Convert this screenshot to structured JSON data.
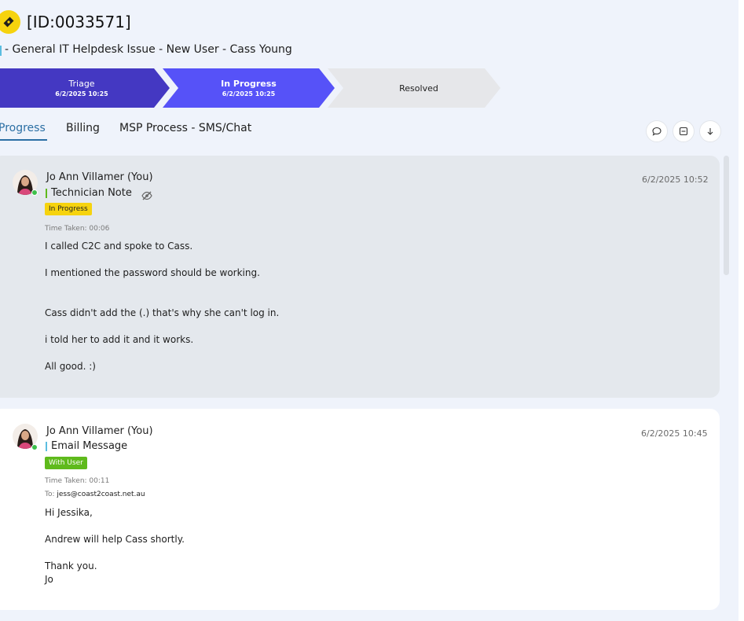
{
  "ticket": {
    "id": "[ID:0033571]",
    "subtitle": "- General IT Helpdesk Issue - New User - Cass Young"
  },
  "steps": [
    {
      "label": "Triage",
      "date": "6/2/2025 10:25"
    },
    {
      "label": "In Progress",
      "date": "6/2/2025 10:25"
    },
    {
      "label": "Resolved"
    }
  ],
  "tabs": [
    "Progress",
    "Billing",
    "MSP Process - SMS/Chat"
  ],
  "notes": [
    {
      "author": "Jo Ann Villamer (You)",
      "type": "Technician Note",
      "type_color": "#5fba1c",
      "status": "In Progress",
      "timestamp": "6/2/2025 10:52",
      "time_taken": "Time Taken: 00:06",
      "lines": [
        "I called C2C and spoke to Cass.",
        "I mentioned the password should be working.",
        "Cass didn't add the (.) that's why she can't log in.",
        "i told her to add it and it works.",
        "All good. :)"
      ]
    },
    {
      "author": "Jo Ann Villamer (You)",
      "type": "Email Message",
      "type_color": "#5bbde0",
      "status": "With User",
      "timestamp": "6/2/2025 10:45",
      "time_taken": "Time Taken: 00:11",
      "to_label": "To:",
      "to_value": "jess@coast2coast.net.au",
      "lines": [
        "Hi Jessika,",
        "Andrew will help Cass shortly.",
        "Thank you.",
        "Jo"
      ]
    }
  ],
  "colors": {
    "accent": "#2b6fa4",
    "triage": "#4438c2",
    "in_progress": "#5652f8",
    "status_yellow": "#f6d30e",
    "status_green": "#5fba1c"
  }
}
